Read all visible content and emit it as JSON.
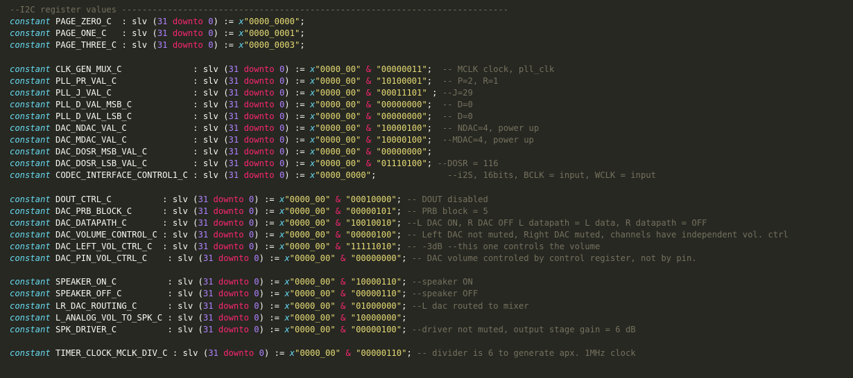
{
  "editor": {
    "lines": [
      {
        "comment": "--I2C register values ----------------------------------------------------------------------------"
      },
      {
        "name": "PAGE_ZERO_C  ",
        "hex": "\"0000_0000\"",
        "tail": ";"
      },
      {
        "name": "PAGE_ONE_C   ",
        "hex": "\"0000_0001\"",
        "tail": ";"
      },
      {
        "name": "PAGE_THREE_C ",
        "hex": "\"0000_0003\"",
        "tail": ";"
      },
      {
        "blank": true
      },
      {
        "name": "CLK_GEN_MUX_C              ",
        "hex": "\"0000_00\"",
        "bin": "\"00000011\"",
        "tail": ";  ",
        "comment": "-- MCLK clock, pll_clk"
      },
      {
        "name": "PLL_PR_VAL_C               ",
        "hex": "\"0000_00\"",
        "bin": "\"10100001\"",
        "tail": ";  ",
        "comment": "-- P=2, R=1"
      },
      {
        "name": "PLL_J_VAL_C                ",
        "hex": "\"0000_00\"",
        "bin": "\"00011101\"",
        "tail": " ; ",
        "comment": "--J=29"
      },
      {
        "name": "PLL_D_VAL_MSB_C            ",
        "hex": "\"0000_00\"",
        "bin": "\"00000000\"",
        "tail": ";  ",
        "comment": "-- D=0"
      },
      {
        "name": "PLL_D_VAL_LSB_C            ",
        "hex": "\"0000_00\"",
        "bin": "\"00000000\"",
        "tail": ";  ",
        "comment": "-- D=0"
      },
      {
        "name": "DAC_NDAC_VAL_C             ",
        "hex": "\"0000_00\"",
        "bin": "\"10000100\"",
        "tail": ";  ",
        "comment": "-- NDAC=4, power up"
      },
      {
        "name": "DAC_MDAC_VAL_C             ",
        "hex": "\"0000_00\"",
        "bin": "\"10000100\"",
        "tail": ";  ",
        "comment": "--MDAC=4, power up"
      },
      {
        "name": "DAC_DOSR_MSB_VAL_C         ",
        "hex": "\"0000_00\"",
        "bin": "\"00000000\"",
        "tail": ";"
      },
      {
        "name": "DAC_DOSR_LSB_VAL_C         ",
        "hex": "\"0000_00\"",
        "bin": "\"01110100\"",
        "tail": "; ",
        "comment": "--DOSR = 116"
      },
      {
        "name": "CODEC_INTERFACE_CONTROL1_C ",
        "hex": "\"0000_0000\"",
        "tail": ";              ",
        "comment": "--i2S, 16bits, BCLK = input, WCLK = input"
      },
      {
        "blank": true
      },
      {
        "name": "DOUT_CTRL_C          ",
        "hex": "\"0000_00\"",
        "bin": "\"00010000\"",
        "tail": "; ",
        "comment": "-- DOUT disabled"
      },
      {
        "name": "DAC_PRB_BLOCK_C      ",
        "hex": "\"0000_00\"",
        "bin": "\"00000101\"",
        "tail": "; ",
        "comment": "-- PRB block = 5"
      },
      {
        "name": "DAC_DATAPATH_C       ",
        "hex": "\"0000_00\"",
        "bin": "\"10010010\"",
        "tail": "; ",
        "comment": "--L DAC ON, R DAC OFF L datapath = L data, R datapath = OFF"
      },
      {
        "name": "DAC_VOLUME_CONTROL_C ",
        "hex": "\"0000_00\"",
        "bin": "\"00000100\"",
        "tail": "; ",
        "comment": "-- Left DAC not muted, Right DAC muted, channels have independent vol. ctrl"
      },
      {
        "name": "DAC_LEFT_VOL_CTRL_C  ",
        "hex": "\"0000_00\"",
        "bin": "\"11111010\"",
        "tail": "; ",
        "comment": "-- -3dB --this one controls the volume"
      },
      {
        "name": "DAC_PIN_VOL_CTRL_C    ",
        "hex": "\"0000_00\"",
        "bin": "\"00000000\"",
        "tail": "; ",
        "comment": "-- DAC volume controled by control register, not by pin."
      },
      {
        "blank": true
      },
      {
        "name": "SPEAKER_ON_C          ",
        "hex": "\"0000_00\"",
        "bin": "\"10000110\"",
        "tail": "; ",
        "comment": "--speaker ON"
      },
      {
        "name": "SPEAKER_OFF_C         ",
        "hex": "\"0000_00\"",
        "bin": "\"00000110\"",
        "tail": "; ",
        "comment": "--speaker OFF"
      },
      {
        "name": "LR_DAC_ROUTING_C      ",
        "hex": "\"0000_00\"",
        "bin": "\"01000000\"",
        "tail": "; ",
        "comment": "--L dac routed to mixer"
      },
      {
        "name": "L_ANALOG_VOL_TO_SPK_C ",
        "hex": "\"0000_00\"",
        "bin": "\"10000000\"",
        "tail": ";"
      },
      {
        "name": "SPK_DRIVER_C          ",
        "hex": "\"0000_00\"",
        "bin": "\"00000100\"",
        "tail": "; ",
        "comment": "--driver not muted, output stage gain = 6 dB"
      },
      {
        "blank": true
      },
      {
        "name": "TIMER_CLOCK_MCLK_DIV_C ",
        "hex": "\"0000_00\"",
        "bin": "\"00000110\"",
        "tail": "; ",
        "comment": "-- divider is 6 to generate apx. 1MHz clock"
      }
    ],
    "tokens": {
      "keyword": "constant",
      "type": ": slv (",
      "high": "31",
      "downto": "downto",
      "low": "0",
      "close": ") :=",
      "x": "x",
      "amp": "&"
    },
    "colors": {
      "background": "#272822",
      "keyword": "#66d9ef",
      "number": "#ae81ff",
      "downto": "#f92672",
      "string": "#e6db74",
      "comment": "#75715e",
      "text": "#f8f8f2"
    }
  }
}
